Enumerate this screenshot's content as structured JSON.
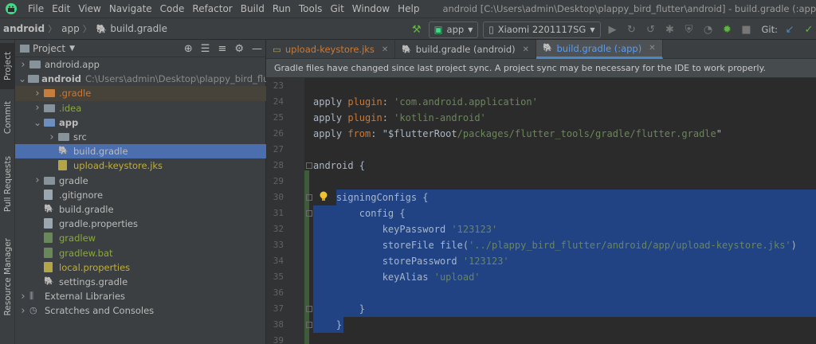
{
  "menubar": {
    "items": [
      "File",
      "Edit",
      "View",
      "Navigate",
      "Code",
      "Refactor",
      "Build",
      "Run",
      "Tools",
      "Git",
      "Window",
      "Help"
    ],
    "window_title": "android [C:\\Users\\admin\\Desktop\\plappy_bird_flutter\\android] - build.gradle (:app)"
  },
  "breadcrumb": {
    "root": "android",
    "module": "app",
    "file": "build.gradle"
  },
  "toolbar": {
    "run_config": "app",
    "device": "Xiaomi 2201117SG",
    "git_label": "Git:"
  },
  "sidebar_tabs": [
    "Project",
    "Commit",
    "Pull Requests",
    "Resource Manager"
  ],
  "project_panel": {
    "title": "Project",
    "tree": [
      {
        "name": "android.app",
        "path": "",
        "depth": 0,
        "expand": "collapsed",
        "icon": "folder",
        "color": "default"
      },
      {
        "name": "android",
        "path": "C:\\Users\\admin\\Desktop\\plappy_bird_flutter\\android",
        "depth": 0,
        "expand": "expanded",
        "icon": "folder",
        "color": "bold"
      },
      {
        "name": ".gradle",
        "path": "",
        "depth": 1,
        "expand": "collapsed",
        "icon": "folder-orange",
        "color": "orange"
      },
      {
        "name": ".idea",
        "path": "",
        "depth": 1,
        "expand": "collapsed",
        "icon": "folder",
        "color": "green"
      },
      {
        "name": "app",
        "path": "",
        "depth": 1,
        "expand": "expanded",
        "icon": "folder-blue",
        "color": "bold"
      },
      {
        "name": "src",
        "path": "",
        "depth": 2,
        "expand": "collapsed",
        "icon": "folder",
        "color": "default"
      },
      {
        "name": "build.gradle",
        "path": "",
        "depth": 2,
        "expand": "none",
        "icon": "gradle",
        "color": "default"
      },
      {
        "name": "upload-keystore.jks",
        "path": "",
        "depth": 2,
        "expand": "none",
        "icon": "file-yellow",
        "color": "yellow"
      },
      {
        "name": "gradle",
        "path": "",
        "depth": 1,
        "expand": "collapsed",
        "icon": "folder",
        "color": "default"
      },
      {
        "name": ".gitignore",
        "path": "",
        "depth": 1,
        "expand": "none",
        "icon": "file",
        "color": "default"
      },
      {
        "name": "build.gradle",
        "path": "",
        "depth": 1,
        "expand": "none",
        "icon": "gradle",
        "color": "default"
      },
      {
        "name": "gradle.properties",
        "path": "",
        "depth": 1,
        "expand": "none",
        "icon": "file",
        "color": "default"
      },
      {
        "name": "gradlew",
        "path": "",
        "depth": 1,
        "expand": "none",
        "icon": "file-green",
        "color": "green"
      },
      {
        "name": "gradlew.bat",
        "path": "",
        "depth": 1,
        "expand": "none",
        "icon": "file-green",
        "color": "green"
      },
      {
        "name": "local.properties",
        "path": "",
        "depth": 1,
        "expand": "none",
        "icon": "file-yellow",
        "color": "yellow"
      },
      {
        "name": "settings.gradle",
        "path": "",
        "depth": 1,
        "expand": "none",
        "icon": "gradle",
        "color": "default"
      },
      {
        "name": "External Libraries",
        "path": "",
        "depth": 0,
        "expand": "collapsed",
        "icon": "library",
        "color": "default"
      },
      {
        "name": "Scratches and Consoles",
        "path": "",
        "depth": 0,
        "expand": "collapsed",
        "icon": "scratch",
        "color": "default"
      }
    ],
    "selected_index": 6,
    "highlighted_index": 2
  },
  "editor_tabs": [
    {
      "label": "upload-keystore.jks",
      "style": "orange",
      "active": false
    },
    {
      "label": "build.gradle (android)",
      "style": "default",
      "active": false
    },
    {
      "label": "build.gradle (:app)",
      "style": "blue",
      "active": true
    }
  ],
  "sync_banner": "Gradle files have changed since last project sync. A project sync may be necessary for the IDE to work properly.",
  "editor": {
    "lines": [
      {
        "n": "23",
        "tokens": []
      },
      {
        "n": "24",
        "tokens": [
          [
            "plain",
            "apply "
          ],
          [
            "kw",
            "plugin"
          ],
          [
            "plain",
            ": "
          ],
          [
            "str",
            "'com.android.application'"
          ]
        ]
      },
      {
        "n": "25",
        "tokens": [
          [
            "plain",
            "apply "
          ],
          [
            "kw",
            "plugin"
          ],
          [
            "plain",
            ": "
          ],
          [
            "str",
            "'kotlin-android'"
          ]
        ]
      },
      {
        "n": "26",
        "tokens": [
          [
            "plain",
            "apply "
          ],
          [
            "kw",
            "from"
          ],
          [
            "plain",
            ": \"$flutterRoot"
          ],
          [
            "str",
            "/packages/flutter_tools/gradle/flutter.gradle"
          ],
          [
            "plain",
            "\""
          ]
        ]
      },
      {
        "n": "27",
        "tokens": []
      },
      {
        "n": "28",
        "tokens": [
          [
            "plain",
            "android {"
          ]
        ]
      },
      {
        "n": "29",
        "tokens": []
      },
      {
        "n": "30",
        "tokens": [
          [
            "plain",
            "    signingConfigs {"
          ]
        ]
      },
      {
        "n": "31",
        "tokens": [
          [
            "plain",
            "        config {"
          ]
        ]
      },
      {
        "n": "32",
        "tokens": [
          [
            "plain",
            "            keyPassword "
          ],
          [
            "str",
            "'123123'"
          ]
        ]
      },
      {
        "n": "33",
        "tokens": [
          [
            "plain",
            "            storeFile file("
          ],
          [
            "str",
            "'../plappy_bird_flutter/android/app/upload-keystore.jks'"
          ],
          [
            "plain",
            ")"
          ]
        ]
      },
      {
        "n": "34",
        "tokens": [
          [
            "plain",
            "            storePassword "
          ],
          [
            "str",
            "'123123'"
          ]
        ]
      },
      {
        "n": "35",
        "tokens": [
          [
            "plain",
            "            keyAlias "
          ],
          [
            "str",
            "'upload'"
          ]
        ]
      },
      {
        "n": "36",
        "tokens": []
      },
      {
        "n": "37",
        "tokens": [
          [
            "plain",
            "        }"
          ]
        ]
      },
      {
        "n": "38",
        "tokens": [
          [
            "plain",
            "    }"
          ]
        ]
      },
      {
        "n": "39",
        "tokens": []
      }
    ],
    "selection_from_line": "30",
    "selection_to_line": "38"
  },
  "colors": {
    "accent": "#4a88c7",
    "selection": "#214283",
    "tree_selection": "#4b6eaf",
    "keyword": "#cc7832",
    "string": "#6a8759"
  }
}
